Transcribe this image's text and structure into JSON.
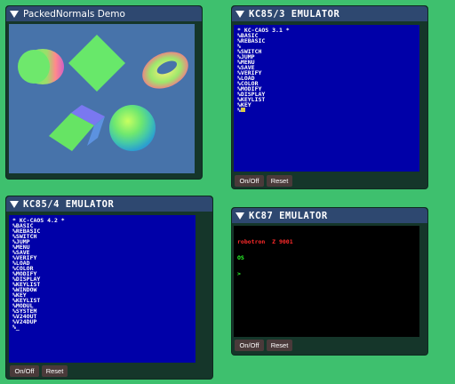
{
  "windows": {
    "packed": {
      "title": "PackedNormals Demo"
    },
    "kc85_3": {
      "title": "KC85/3 EMULATOR",
      "lines": [
        "* KC-CAOS 3.1 *",
        "%BASIC",
        "%REBASIC",
        "%",
        "%SWITCH",
        "%JUMP",
        "%MENU",
        "%SAVE",
        "%VERIFY",
        "%LOAD",
        "%COLOR",
        "%MODIFY",
        "%DISPLAY",
        "%KEYLIST",
        "%KEY",
        "%"
      ],
      "buttons": {
        "onoff": "On/Off",
        "reset": "Reset"
      }
    },
    "kc85_4": {
      "title": "KC85/4 EMULATOR",
      "lines": [
        "* KC-CAOS 4.2 *",
        "%BASIC",
        "%REBASIC",
        "%SWITCH",
        "%JUMP",
        "%MENU",
        "%SAVE",
        "%VERIFY",
        "%LOAD",
        "%COLOR",
        "%MODIFY",
        "%DISPLAY",
        "%KEYLIST",
        "%WINDOW",
        "%KEY",
        "%KEYLIST",
        "%MODUL",
        "%SYSTEM",
        "%V24OUT",
        "%V24DUP",
        "%_"
      ],
      "buttons": {
        "onoff": "On/Off",
        "reset": "Reset"
      }
    },
    "kc87": {
      "title": "KC87 EMULATOR",
      "line1": "robotron  Z 9001",
      "line2": "OS",
      "line3": ">",
      "buttons": {
        "onoff": "On/Off",
        "reset": "Reset"
      }
    }
  },
  "colors": {
    "background": "#3ec06e",
    "titlebar": "#2e4870",
    "window_body": "#15362a",
    "screen_blue": "#0000a8",
    "screen_black": "#000000",
    "button": "#4a3a3a"
  }
}
